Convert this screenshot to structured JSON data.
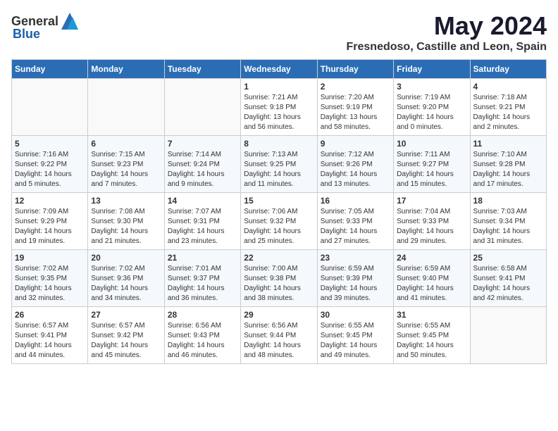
{
  "header": {
    "logo_general": "General",
    "logo_blue": "Blue",
    "title": "May 2024",
    "subtitle": "Fresnedoso, Castille and Leon, Spain"
  },
  "days_of_week": [
    "Sunday",
    "Monday",
    "Tuesday",
    "Wednesday",
    "Thursday",
    "Friday",
    "Saturday"
  ],
  "weeks": [
    [
      {
        "day": "",
        "sunrise": "",
        "sunset": "",
        "daylight": ""
      },
      {
        "day": "",
        "sunrise": "",
        "sunset": "",
        "daylight": ""
      },
      {
        "day": "",
        "sunrise": "",
        "sunset": "",
        "daylight": ""
      },
      {
        "day": "1",
        "sunrise": "Sunrise: 7:21 AM",
        "sunset": "Sunset: 9:18 PM",
        "daylight": "Daylight: 13 hours and 56 minutes."
      },
      {
        "day": "2",
        "sunrise": "Sunrise: 7:20 AM",
        "sunset": "Sunset: 9:19 PM",
        "daylight": "Daylight: 13 hours and 58 minutes."
      },
      {
        "day": "3",
        "sunrise": "Sunrise: 7:19 AM",
        "sunset": "Sunset: 9:20 PM",
        "daylight": "Daylight: 14 hours and 0 minutes."
      },
      {
        "day": "4",
        "sunrise": "Sunrise: 7:18 AM",
        "sunset": "Sunset: 9:21 PM",
        "daylight": "Daylight: 14 hours and 2 minutes."
      }
    ],
    [
      {
        "day": "5",
        "sunrise": "Sunrise: 7:16 AM",
        "sunset": "Sunset: 9:22 PM",
        "daylight": "Daylight: 14 hours and 5 minutes."
      },
      {
        "day": "6",
        "sunrise": "Sunrise: 7:15 AM",
        "sunset": "Sunset: 9:23 PM",
        "daylight": "Daylight: 14 hours and 7 minutes."
      },
      {
        "day": "7",
        "sunrise": "Sunrise: 7:14 AM",
        "sunset": "Sunset: 9:24 PM",
        "daylight": "Daylight: 14 hours and 9 minutes."
      },
      {
        "day": "8",
        "sunrise": "Sunrise: 7:13 AM",
        "sunset": "Sunset: 9:25 PM",
        "daylight": "Daylight: 14 hours and 11 minutes."
      },
      {
        "day": "9",
        "sunrise": "Sunrise: 7:12 AM",
        "sunset": "Sunset: 9:26 PM",
        "daylight": "Daylight: 14 hours and 13 minutes."
      },
      {
        "day": "10",
        "sunrise": "Sunrise: 7:11 AM",
        "sunset": "Sunset: 9:27 PM",
        "daylight": "Daylight: 14 hours and 15 minutes."
      },
      {
        "day": "11",
        "sunrise": "Sunrise: 7:10 AM",
        "sunset": "Sunset: 9:28 PM",
        "daylight": "Daylight: 14 hours and 17 minutes."
      }
    ],
    [
      {
        "day": "12",
        "sunrise": "Sunrise: 7:09 AM",
        "sunset": "Sunset: 9:29 PM",
        "daylight": "Daylight: 14 hours and 19 minutes."
      },
      {
        "day": "13",
        "sunrise": "Sunrise: 7:08 AM",
        "sunset": "Sunset: 9:30 PM",
        "daylight": "Daylight: 14 hours and 21 minutes."
      },
      {
        "day": "14",
        "sunrise": "Sunrise: 7:07 AM",
        "sunset": "Sunset: 9:31 PM",
        "daylight": "Daylight: 14 hours and 23 minutes."
      },
      {
        "day": "15",
        "sunrise": "Sunrise: 7:06 AM",
        "sunset": "Sunset: 9:32 PM",
        "daylight": "Daylight: 14 hours and 25 minutes."
      },
      {
        "day": "16",
        "sunrise": "Sunrise: 7:05 AM",
        "sunset": "Sunset: 9:33 PM",
        "daylight": "Daylight: 14 hours and 27 minutes."
      },
      {
        "day": "17",
        "sunrise": "Sunrise: 7:04 AM",
        "sunset": "Sunset: 9:33 PM",
        "daylight": "Daylight: 14 hours and 29 minutes."
      },
      {
        "day": "18",
        "sunrise": "Sunrise: 7:03 AM",
        "sunset": "Sunset: 9:34 PM",
        "daylight": "Daylight: 14 hours and 31 minutes."
      }
    ],
    [
      {
        "day": "19",
        "sunrise": "Sunrise: 7:02 AM",
        "sunset": "Sunset: 9:35 PM",
        "daylight": "Daylight: 14 hours and 32 minutes."
      },
      {
        "day": "20",
        "sunrise": "Sunrise: 7:02 AM",
        "sunset": "Sunset: 9:36 PM",
        "daylight": "Daylight: 14 hours and 34 minutes."
      },
      {
        "day": "21",
        "sunrise": "Sunrise: 7:01 AM",
        "sunset": "Sunset: 9:37 PM",
        "daylight": "Daylight: 14 hours and 36 minutes."
      },
      {
        "day": "22",
        "sunrise": "Sunrise: 7:00 AM",
        "sunset": "Sunset: 9:38 PM",
        "daylight": "Daylight: 14 hours and 38 minutes."
      },
      {
        "day": "23",
        "sunrise": "Sunrise: 6:59 AM",
        "sunset": "Sunset: 9:39 PM",
        "daylight": "Daylight: 14 hours and 39 minutes."
      },
      {
        "day": "24",
        "sunrise": "Sunrise: 6:59 AM",
        "sunset": "Sunset: 9:40 PM",
        "daylight": "Daylight: 14 hours and 41 minutes."
      },
      {
        "day": "25",
        "sunrise": "Sunrise: 6:58 AM",
        "sunset": "Sunset: 9:41 PM",
        "daylight": "Daylight: 14 hours and 42 minutes."
      }
    ],
    [
      {
        "day": "26",
        "sunrise": "Sunrise: 6:57 AM",
        "sunset": "Sunset: 9:41 PM",
        "daylight": "Daylight: 14 hours and 44 minutes."
      },
      {
        "day": "27",
        "sunrise": "Sunrise: 6:57 AM",
        "sunset": "Sunset: 9:42 PM",
        "daylight": "Daylight: 14 hours and 45 minutes."
      },
      {
        "day": "28",
        "sunrise": "Sunrise: 6:56 AM",
        "sunset": "Sunset: 9:43 PM",
        "daylight": "Daylight: 14 hours and 46 minutes."
      },
      {
        "day": "29",
        "sunrise": "Sunrise: 6:56 AM",
        "sunset": "Sunset: 9:44 PM",
        "daylight": "Daylight: 14 hours and 48 minutes."
      },
      {
        "day": "30",
        "sunrise": "Sunrise: 6:55 AM",
        "sunset": "Sunset: 9:45 PM",
        "daylight": "Daylight: 14 hours and 49 minutes."
      },
      {
        "day": "31",
        "sunrise": "Sunrise: 6:55 AM",
        "sunset": "Sunset: 9:45 PM",
        "daylight": "Daylight: 14 hours and 50 minutes."
      },
      {
        "day": "",
        "sunrise": "",
        "sunset": "",
        "daylight": ""
      }
    ]
  ]
}
